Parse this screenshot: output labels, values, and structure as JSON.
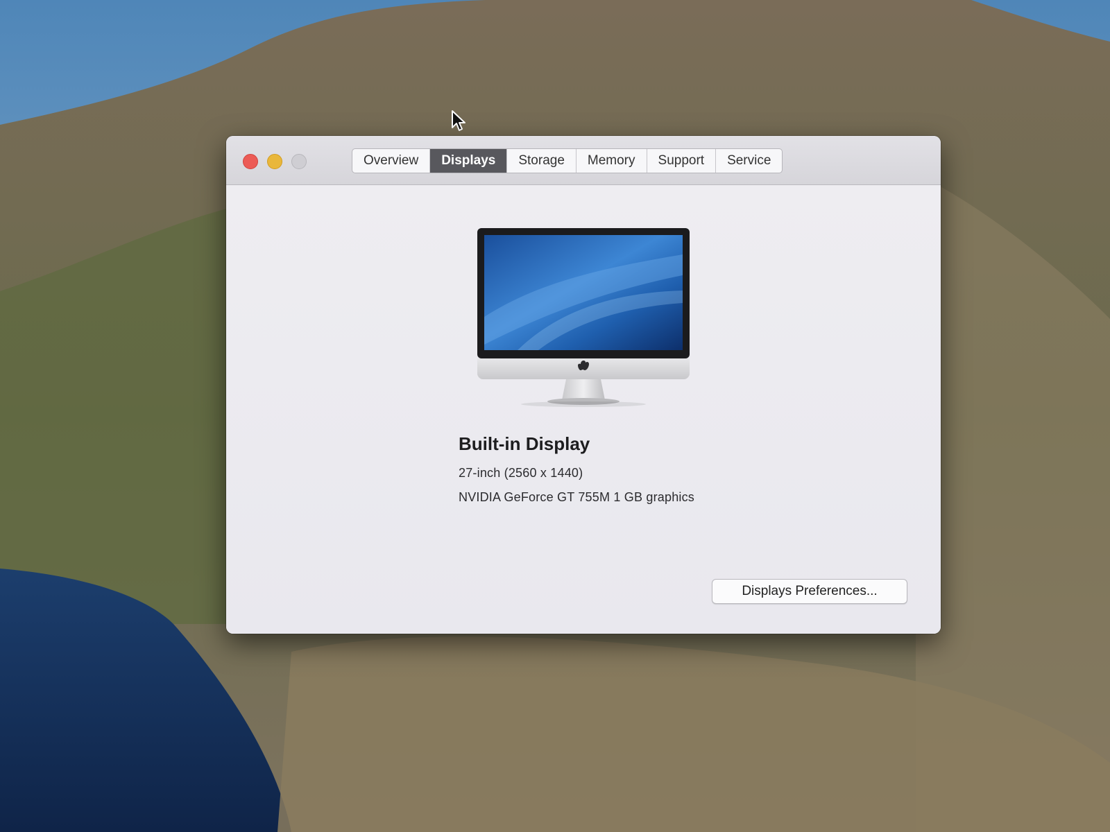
{
  "window": {
    "tabs": [
      {
        "label": "Overview"
      },
      {
        "label": "Displays"
      },
      {
        "label": "Storage"
      },
      {
        "label": "Memory"
      },
      {
        "label": "Support"
      },
      {
        "label": "Service"
      }
    ],
    "active_tab": "Displays"
  },
  "display_info": {
    "title": "Built-in Display",
    "size_resolution": "27-inch (2560 x 1440)",
    "graphics": "NVIDIA GeForce GT 755M 1 GB graphics"
  },
  "buttons": {
    "preferences_label": "Displays Preferences..."
  },
  "colors": {
    "close": "#ec5b56",
    "minimize": "#e9b73b",
    "zoom_disabled": "#cfced3",
    "active_tab": "#58585d"
  },
  "icons": {
    "display_illustration": "imac-display-icon",
    "cursor": "mouse-pointer-icon"
  }
}
